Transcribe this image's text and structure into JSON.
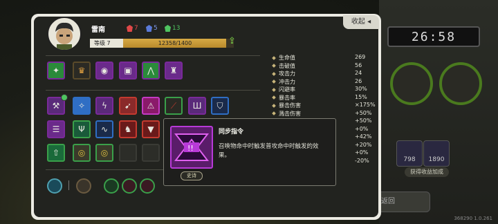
{
  "window": {
    "version": "368290 1.0.261"
  },
  "background": {
    "clock": "26:58",
    "gain_button": "获得收益加成",
    "bottom_button": "返回",
    "side_values": [
      "798",
      "1890"
    ]
  },
  "player": {
    "name": "雷南",
    "level_label": "等级 7",
    "xp_text": "12358/1400",
    "xp_progress": 0.93
  },
  "resources": [
    {
      "value": "7",
      "color": "#e04848"
    },
    {
      "value": "5",
      "color": "#5a7ad8"
    },
    {
      "value": "13",
      "color": "#4fc460"
    }
  ],
  "collapse_label": "收起",
  "stats": [
    {
      "label": "生命值",
      "value": "269"
    },
    {
      "label": "击破值",
      "value": "56"
    },
    {
      "label": "攻击力",
      "value": "24"
    },
    {
      "label": "冲击力",
      "value": "26"
    },
    {
      "label": "闪避率",
      "value": "30%"
    },
    {
      "label": "暴击率",
      "value": "15%"
    },
    {
      "label": "暴击伤害",
      "value": "×175%"
    },
    {
      "label": "溅击伤害",
      "value": "+50%"
    },
    {
      "label": "",
      "value": "+50%"
    },
    {
      "label": "",
      "value": "+0%"
    },
    {
      "label": "",
      "value": "+42%"
    },
    {
      "label": "",
      "value": "+20%"
    },
    {
      "label": "",
      "value": "+0%"
    },
    {
      "label": "",
      "value": "-20%"
    }
  ],
  "tooltip": {
    "title": "同步指令",
    "description": "召唤物命中时触发普攻命中时触发的效果。",
    "rarity": "史诗"
  },
  "icon_colors": {
    "epic": "#9b2fc4",
    "rare": "#2f6ec4",
    "legend": "#c43a2f",
    "green": "#3aa04a"
  }
}
